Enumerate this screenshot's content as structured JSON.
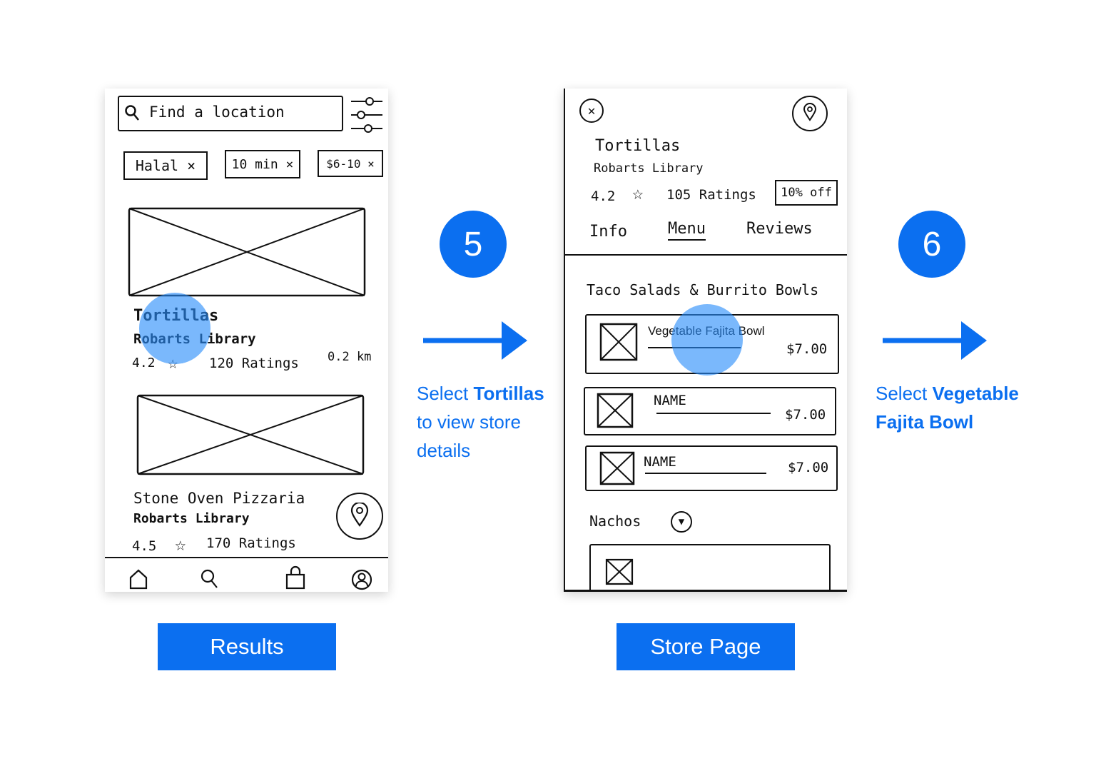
{
  "results": {
    "search_placeholder": "Find a location",
    "filters": [
      "Halal ×",
      "10 min ×",
      "$6-10 ×"
    ],
    "stores": [
      {
        "name": "Tortillas",
        "location": "Robarts Library",
        "rating": "4.2",
        "ratings": "120 Ratings",
        "distance": "0.2 km"
      },
      {
        "name": "Stone Oven Pizzaria",
        "location": "Robarts Library",
        "rating": "4.5",
        "ratings": "170 Ratings"
      }
    ],
    "label": "Results"
  },
  "store": {
    "name": "Tortillas",
    "location": "Robarts Library",
    "rating": "4.2",
    "ratings": "105 Ratings",
    "discount": "10% off",
    "tabs": [
      "Info",
      "Menu",
      "Reviews"
    ],
    "section1": "Taco Salads & Burrito Bowls",
    "items": [
      {
        "name": "Vegetable Fajita Bowl",
        "price": "$7.00"
      },
      {
        "name": "NAME",
        "price": "$7.00"
      },
      {
        "name": "NAME",
        "price": "$7.00"
      }
    ],
    "section2": "Nachos",
    "label": "Store Page"
  },
  "steps": [
    {
      "number": "5",
      "pre": "Select ",
      "bold": "Tortillas",
      "post": " to view store details"
    },
    {
      "number": "6",
      "pre": "Select ",
      "bold": "Vegetable Fajita Bowl",
      "post": ""
    }
  ],
  "colors": {
    "accent": "#0b6ff0",
    "tap": "#288cfa"
  }
}
